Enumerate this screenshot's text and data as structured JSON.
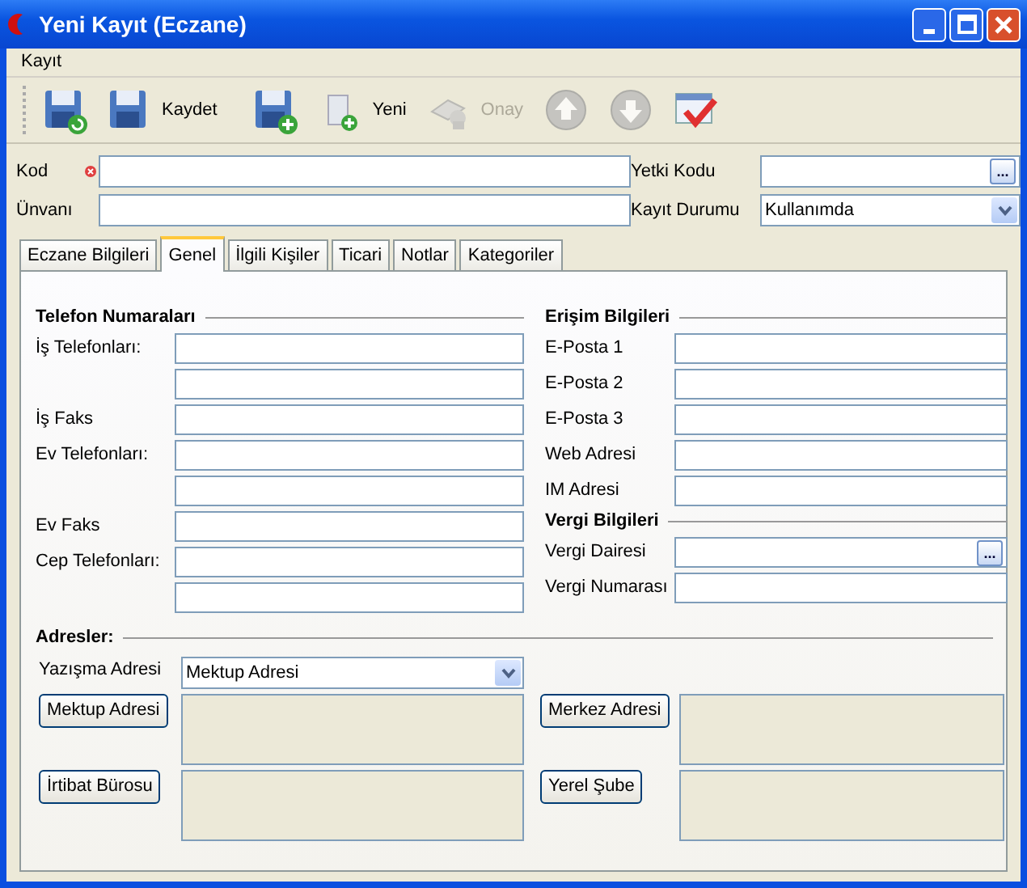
{
  "window": {
    "title": "Yeni Kayıt (Eczane)"
  },
  "menu": [
    "Kayıt"
  ],
  "toolbar": [
    {
      "disabled": false
    },
    {
      "label": "Kaydet",
      "disabled": false
    },
    {
      "disabled": false
    },
    {
      "label": "Yeni",
      "disabled": false
    },
    {
      "label": "Onay",
      "disabled": true
    },
    {
      "disabled": true
    },
    {
      "disabled": true
    },
    {
      "disabled": false
    }
  ],
  "header": {
    "left": [
      {
        "label": "Kod",
        "required": true
      },
      {
        "label": "Ünvanı",
        "required": false
      }
    ],
    "right": [
      {
        "label": "Yetki Kodu",
        "kind": "lookup",
        "button": "..."
      },
      {
        "label": "Kayıt Durumu",
        "kind": "select",
        "value": "Kullanımda"
      }
    ]
  },
  "tabs": [
    {
      "label": "Eczane Bilgileri",
      "selected": false
    },
    {
      "label": "Genel",
      "selected": true
    },
    {
      "label": "İlgili Kişiler",
      "selected": false
    },
    {
      "label": "Ticari",
      "selected": false
    },
    {
      "label": "Notlar",
      "selected": false
    },
    {
      "label": "Kategoriler",
      "selected": false
    }
  ],
  "left_groups": [
    {
      "title": "Telefon Numaraları",
      "rows": [
        {
          "label": "İş Telefonları:",
          "kind": "text"
        },
        {
          "kind": "text"
        },
        {
          "label": "İş Faks",
          "kind": "text"
        },
        {
          "label": "Ev Telefonları:",
          "kind": "text"
        },
        {
          "kind": "text"
        },
        {
          "label": "Ev Faks",
          "kind": "text"
        },
        {
          "label": "Cep Telefonları:",
          "kind": "text"
        },
        {
          "kind": "text"
        }
      ]
    }
  ],
  "right_groups": [
    {
      "title": "Erişim Bilgileri",
      "rows": [
        {
          "label": "E-Posta 1",
          "kind": "text"
        },
        {
          "label": "E-Posta 2",
          "kind": "text"
        },
        {
          "label": "E-Posta 3",
          "kind": "text"
        },
        {
          "label": "Web Adresi",
          "kind": "text"
        },
        {
          "label": "IM Adresi",
          "kind": "text"
        }
      ]
    },
    {
      "title": "Vergi Bilgileri",
      "rows": [
        {
          "label": "Vergi Dairesi",
          "kind": "lookup",
          "button": "..."
        },
        {
          "label": "Vergi Numarası",
          "kind": "text"
        }
      ]
    }
  ],
  "addresses": {
    "title": "Adresler:",
    "correspondence": {
      "label": "Yazışma Adresi",
      "value": "Mektup Adresi"
    },
    "buttons": [
      "Mektup Adresi",
      "Merkez Adresi",
      "İrtibat Bürosu",
      "Yerel Şube"
    ]
  }
}
